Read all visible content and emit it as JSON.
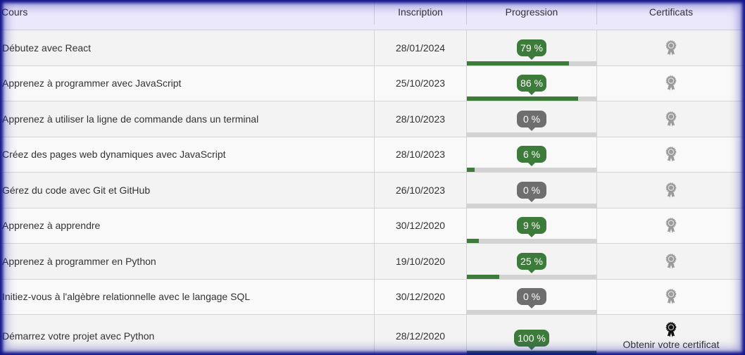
{
  "table": {
    "headers": {
      "course": "Cours",
      "enrollment": "Inscription",
      "progress": "Progression",
      "certificates": "Certificats"
    },
    "rows": [
      {
        "course": "Débutez avec React",
        "enrolled": "28/01/2024",
        "progress_label": "79 %",
        "progress_percent": 79,
        "certificate_unlocked": false
      },
      {
        "course": "Apprenez à programmer avec JavaScript",
        "enrolled": "25/10/2023",
        "progress_label": "86 %",
        "progress_percent": 86,
        "certificate_unlocked": false
      },
      {
        "course": "Apprenez à utiliser la ligne de commande dans un terminal",
        "enrolled": "28/10/2023",
        "progress_label": "0 %",
        "progress_percent": 0,
        "certificate_unlocked": false
      },
      {
        "course": "Créez des pages web dynamiques avec JavaScript",
        "enrolled": "28/10/2023",
        "progress_label": "6 %",
        "progress_percent": 6,
        "certificate_unlocked": false
      },
      {
        "course": "Gérez du code avec Git et GitHub",
        "enrolled": "26/10/2023",
        "progress_label": "0 %",
        "progress_percent": 0,
        "certificate_unlocked": false
      },
      {
        "course": "Apprenez à apprendre",
        "enrolled": "30/12/2020",
        "progress_label": "9 %",
        "progress_percent": 9,
        "certificate_unlocked": false
      },
      {
        "course": "Apprenez à programmer en Python",
        "enrolled": "19/10/2020",
        "progress_label": "25 %",
        "progress_percent": 25,
        "certificate_unlocked": false
      },
      {
        "course": "Initiez-vous à l'algèbre relationnelle avec le langage SQL",
        "enrolled": "30/12/2020",
        "progress_label": "0 %",
        "progress_percent": 0,
        "certificate_unlocked": false
      },
      {
        "course": "Démarrez votre projet avec Python",
        "enrolled": "28/12/2020",
        "progress_label": "100 %",
        "progress_percent": 100,
        "certificate_unlocked": true,
        "certificate_action": "Obtenir votre certificat"
      }
    ]
  },
  "icons": {
    "certificate": "award-icon"
  },
  "colors": {
    "header_background": "#ebe8fb",
    "progress_active": "#3d7b3a",
    "progress_zero": "#6e6e6e",
    "progress_track": "#d2d2d2",
    "certificate_locked": "#9a9a9a",
    "certificate_unlocked": "#111111",
    "frame": "#14148a"
  }
}
